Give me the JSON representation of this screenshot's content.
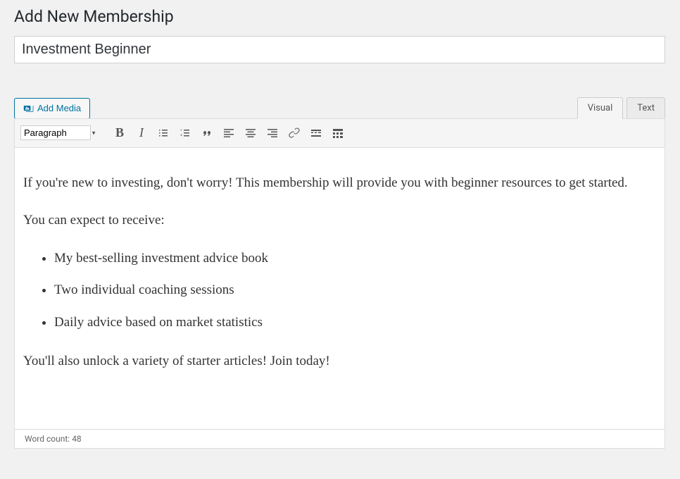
{
  "pageTitle": "Add New Membership",
  "titleValue": "Investment Beginner",
  "addMediaLabel": "Add Media",
  "tabs": {
    "visual": "Visual",
    "text": "Text"
  },
  "formatSelect": "Paragraph",
  "content": {
    "p1": "If you're new to investing, don't worry! This membership will provide you with beginner resources to get started.",
    "p2": "You can expect to receive:",
    "li1": "My best-selling investment advice book",
    "li2": "Two individual coaching sessions",
    "li3": "Daily advice based on market statistics",
    "p3": "You'll also unlock a variety of starter articles! Join today!"
  },
  "wordCountLabel": "Word count: ",
  "wordCount": "48"
}
